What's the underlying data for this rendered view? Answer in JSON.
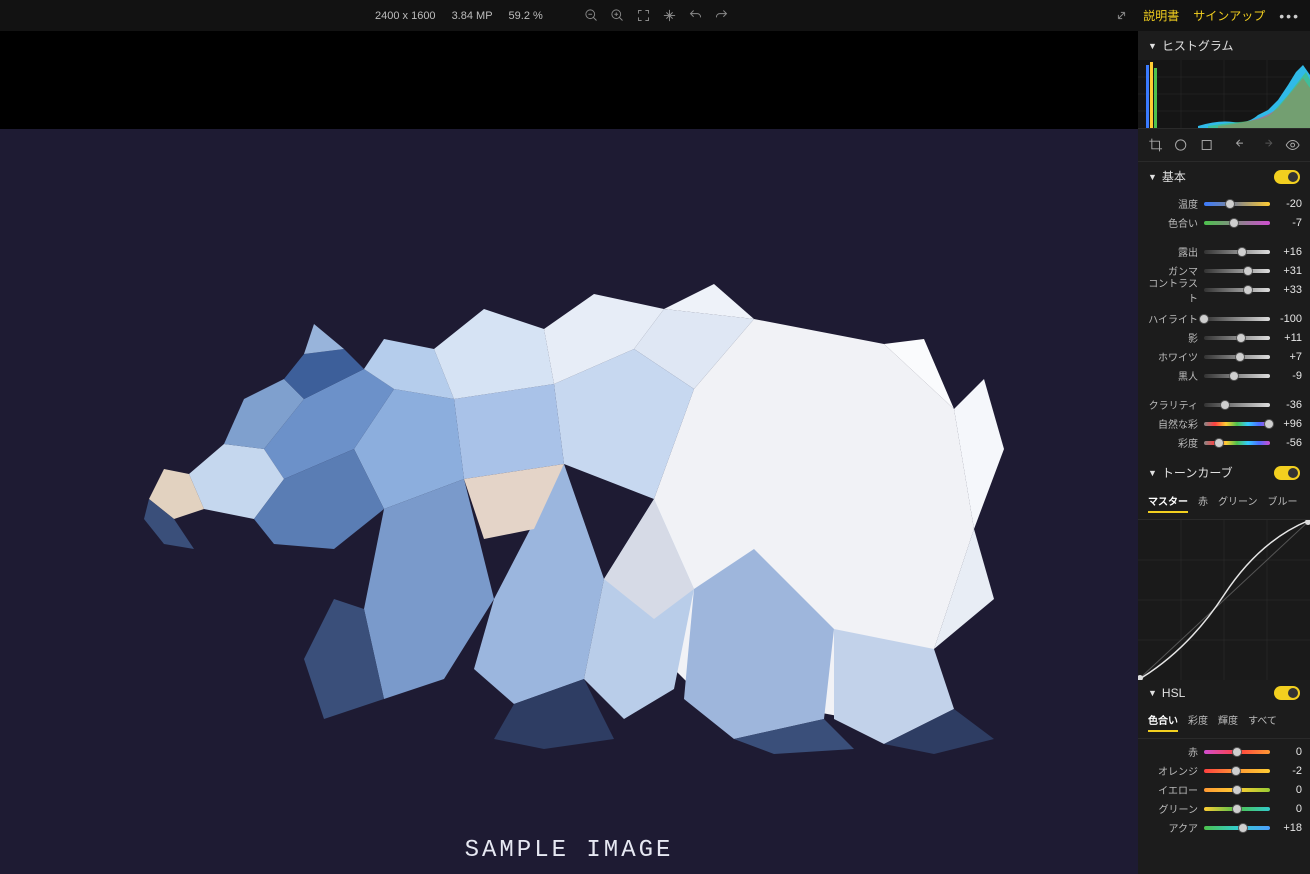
{
  "topbar": {
    "dimensions": "2400 x 1600",
    "megapixels": "3.84 MP",
    "zoom": "59.2 %",
    "manual_link": "説明書",
    "signup_link": "サインアップ"
  },
  "canvas": {
    "sample_text": "SAMPLE IMAGE"
  },
  "sections": {
    "histogram": "ヒストグラム",
    "basic": "基本",
    "tone_curve": "トーンカーブ",
    "hsl": "HSL"
  },
  "basic_controls": {
    "g1": [
      {
        "label": "温度",
        "value": "-20",
        "pos": 40,
        "gradient": "linear-gradient(to right,#3a7bff,#888,#ffcc33)"
      },
      {
        "label": "色合い",
        "value": "-7",
        "pos": 46,
        "gradient": "linear-gradient(to right,#4dc24d,#888,#d04dd0)"
      }
    ],
    "g2": [
      {
        "label": "露出",
        "value": "+16",
        "pos": 58,
        "gradient": "linear-gradient(to right,#333,#ddd)"
      },
      {
        "label": "ガンマ",
        "value": "+31",
        "pos": 66,
        "gradient": "linear-gradient(to right,#333,#ddd)"
      },
      {
        "label": "コントラスト",
        "value": "+33",
        "pos": 67,
        "gradient": "linear-gradient(to right,#333,#ddd)"
      }
    ],
    "g3": [
      {
        "label": "ハイライト",
        "value": "-100",
        "pos": 0,
        "gradient": "linear-gradient(to right,#333,#ddd)"
      },
      {
        "label": "影",
        "value": "+11",
        "pos": 56,
        "gradient": "linear-gradient(to right,#333,#ddd)"
      },
      {
        "label": "ホワイツ",
        "value": "+7",
        "pos": 54,
        "gradient": "linear-gradient(to right,#333,#ddd)"
      },
      {
        "label": "黒人",
        "value": "-9",
        "pos": 45,
        "gradient": "linear-gradient(to right,#333,#ddd)"
      }
    ],
    "g4": [
      {
        "label": "クラリティ",
        "value": "-36",
        "pos": 32,
        "gradient": "linear-gradient(to right,#333,#ddd)"
      },
      {
        "label": "自然な彩",
        "value": "+96",
        "pos": 98,
        "gradient": "linear-gradient(to right,#888,#ff4040,#ffcc33,#4dc24d,#33ccff,#4d6dff,#d04dd0)"
      },
      {
        "label": "彩度",
        "value": "-56",
        "pos": 22,
        "gradient": "linear-gradient(to right,#888,#ff4040,#ffcc33,#4dc24d,#33ccff,#4d6dff,#d04dd0)"
      }
    ]
  },
  "curve_tabs": [
    "マスター",
    "赤",
    "グリーン",
    "ブルー"
  ],
  "hsl_tabs": [
    "色合い",
    "彩度",
    "輝度",
    "すべて"
  ],
  "hsl_controls": [
    {
      "label": "赤",
      "value": "0",
      "pos": 50,
      "gradient": "linear-gradient(to right,#d04dd0,#ff4040,#ff9933)"
    },
    {
      "label": "オレンジ",
      "value": "-2",
      "pos": 49,
      "gradient": "linear-gradient(to right,#ff4040,#ff9933,#ffcc33)"
    },
    {
      "label": "イエロー",
      "value": "0",
      "pos": 50,
      "gradient": "linear-gradient(to right,#ff9933,#ffcc33,#99cc33)"
    },
    {
      "label": "グリーン",
      "value": "0",
      "pos": 50,
      "gradient": "linear-gradient(to right,#ffcc33,#4dc24d,#33cccc)"
    },
    {
      "label": "アクア",
      "value": "+18",
      "pos": 59,
      "gradient": "linear-gradient(to right,#4dc24d,#33cccc,#4d9fff)"
    }
  ]
}
